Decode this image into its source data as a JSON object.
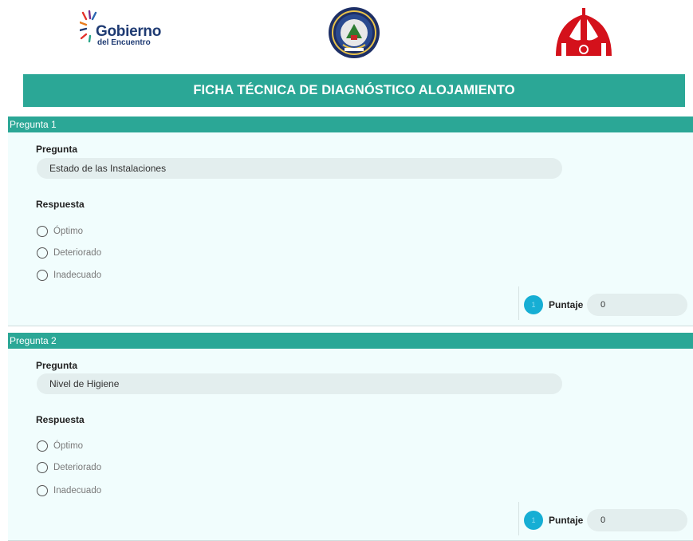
{
  "logos": {
    "gobierno_line1": "Gobierno",
    "gobierno_line2": "del Encuentro"
  },
  "title": "FICHA TÉCNICA DE DIAGNÓSTICO ALOJAMIENTO",
  "questions": [
    {
      "header": "Pregunta 1",
      "question_label": "Pregunta",
      "question_value": "Estado de las Instalaciones",
      "answer_label": "Respuesta",
      "options": [
        "Óptimo",
        "Deteriorado",
        "Inadecuado"
      ],
      "badge": "1",
      "score_label": "Puntaje",
      "score_value": "0"
    },
    {
      "header": "Pregunta 2",
      "question_label": "Pregunta",
      "question_value": "Nivel de Higiene",
      "answer_label": "Respuesta",
      "options": [
        "Óptimo",
        "Deteriorado",
        "Inadecuado"
      ],
      "badge": "1",
      "score_label": "Puntaje",
      "score_value": "0"
    }
  ],
  "colors": {
    "primary": "#2ba796",
    "card_bg": "#f1fdfd",
    "field_bg": "#e3eeee",
    "badge": "#16aed4",
    "logo_red": "#d4111b",
    "logo_blue": "#1f3b73"
  }
}
